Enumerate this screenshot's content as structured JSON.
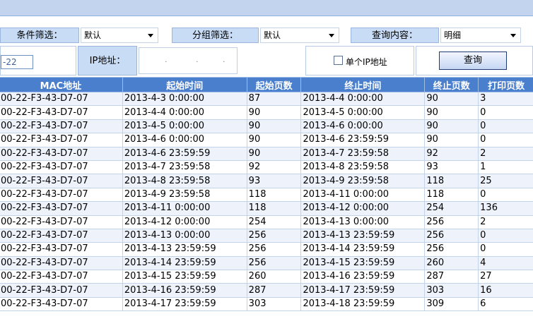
{
  "filters": {
    "condition_label": "条件筛选：",
    "condition_value": "默认",
    "group_label": "分组筛选：",
    "group_value": "默认",
    "query_content_label": "查询内容：",
    "query_content_value": "明细"
  },
  "search": {
    "mac_fragment": "-22",
    "ip_label": "IP地址：",
    "single_ip_label": "单个IP地址",
    "query_button": "查询"
  },
  "table": {
    "columns": [
      "MAC地址",
      "起始时间",
      "起始页数",
      "终止时间",
      "终止页数",
      "打印页数"
    ],
    "rows": [
      [
        "00-22-F3-43-D7-07",
        "2013-4-3 0:00:00",
        "87",
        "2013-4-4 0:00:00",
        "90",
        "3"
      ],
      [
        "00-22-F3-43-D7-07",
        "2013-4-4 0:00:00",
        "90",
        "2013-4-5 0:00:00",
        "90",
        "0"
      ],
      [
        "00-22-F3-43-D7-07",
        "2013-4-5 0:00:00",
        "90",
        "2013-4-6 0:00:00",
        "90",
        "0"
      ],
      [
        "00-22-F3-43-D7-07",
        "2013-4-6 0:00:00",
        "90",
        "2013-4-6 23:59:59",
        "90",
        "0"
      ],
      [
        "00-22-F3-43-D7-07",
        "2013-4-6 23:59:59",
        "90",
        "2013-4-7 23:59:58",
        "92",
        "2"
      ],
      [
        "00-22-F3-43-D7-07",
        "2013-4-7 23:59:58",
        "92",
        "2013-4-8 23:59:58",
        "93",
        "1"
      ],
      [
        "00-22-F3-43-D7-07",
        "2013-4-8 23:59:58",
        "93",
        "2013-4-9 23:59:58",
        "118",
        "25"
      ],
      [
        "00-22-F3-43-D7-07",
        "2013-4-9 23:59:58",
        "118",
        "2013-4-11 0:00:00",
        "118",
        "0"
      ],
      [
        "00-22-F3-43-D7-07",
        "2013-4-11 0:00:00",
        "118",
        "2013-4-12 0:00:00",
        "254",
        "136"
      ],
      [
        "00-22-F3-43-D7-07",
        "2013-4-12 0:00:00",
        "254",
        "2013-4-13 0:00:00",
        "256",
        "2"
      ],
      [
        "00-22-F3-43-D7-07",
        "2013-4-13 0:00:00",
        "256",
        "2013-4-13 23:59:59",
        "256",
        "0"
      ],
      [
        "00-22-F3-43-D7-07",
        "2013-4-13 23:59:59",
        "256",
        "2013-4-14 23:59:59",
        "256",
        "0"
      ],
      [
        "00-22-F3-43-D7-07",
        "2013-4-14 23:59:59",
        "256",
        "2013-4-15 23:59:59",
        "260",
        "4"
      ],
      [
        "00-22-F3-43-D7-07",
        "2013-4-15 23:59:59",
        "260",
        "2013-4-16 23:59:59",
        "287",
        "27"
      ],
      [
        "00-22-F3-43-D7-07",
        "2013-4-16 23:59:59",
        "287",
        "2013-4-17 23:59:59",
        "303",
        "16"
      ],
      [
        "00-22-F3-43-D7-07",
        "2013-4-17 23:59:59",
        "303",
        "2013-4-18 23:59:59",
        "309",
        "6"
      ]
    ]
  }
}
